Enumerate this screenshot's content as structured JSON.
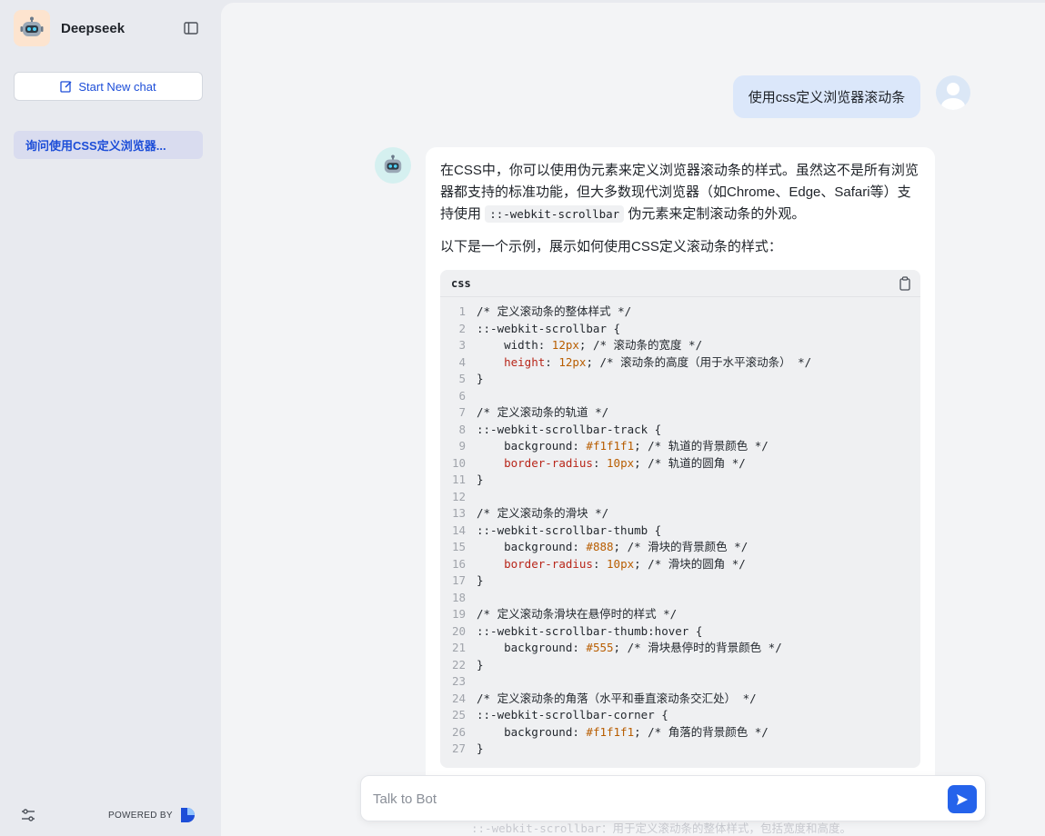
{
  "sidebar": {
    "brand_name": "Deepseek",
    "new_chat_label": "Start New chat",
    "history": [
      {
        "label": "询问使用CSS定义浏览器..."
      }
    ],
    "powered_by": "POWERED BY"
  },
  "chat": {
    "user_message": "使用css定义浏览器滚动条",
    "bot_para1_a": "在CSS中，你可以使用伪元素来定义浏览器滚动条的样式。虽然这不是所有浏览器都支持的标准功能，但大多数现代浏览器（如Chrome、Edge、Safari等）支持使用",
    "bot_para1_code": "::-webkit-scrollbar",
    "bot_para1_b": "伪元素来定制滚动条的外观。",
    "bot_para2": "以下是一个示例，展示如何使用CSS定义滚动条的样式：",
    "code_lang": "css",
    "code_lines": [
      {
        "n": "1",
        "t": "/* 定义滚动条的整体样式 */"
      },
      {
        "n": "2",
        "t": "::-webkit-scrollbar {"
      },
      {
        "n": "3",
        "t": "    width: 12px; /* 滚动条的宽度 */"
      },
      {
        "n": "4",
        "t": "    height: 12px; /* 滚动条的高度（用于水平滚动条） */"
      },
      {
        "n": "5",
        "t": "}"
      },
      {
        "n": "6",
        "t": ""
      },
      {
        "n": "7",
        "t": "/* 定义滚动条的轨道 */"
      },
      {
        "n": "8",
        "t": "::-webkit-scrollbar-track {"
      },
      {
        "n": "9",
        "t": "    background: #f1f1f1; /* 轨道的背景颜色 */"
      },
      {
        "n": "10",
        "t": "    border-radius: 10px; /* 轨道的圆角 */"
      },
      {
        "n": "11",
        "t": "}"
      },
      {
        "n": "12",
        "t": ""
      },
      {
        "n": "13",
        "t": "/* 定义滚动条的滑块 */"
      },
      {
        "n": "14",
        "t": "::-webkit-scrollbar-thumb {"
      },
      {
        "n": "15",
        "t": "    background: #888; /* 滑块的背景颜色 */"
      },
      {
        "n": "16",
        "t": "    border-radius: 10px; /* 滑块的圆角 */"
      },
      {
        "n": "17",
        "t": "}"
      },
      {
        "n": "18",
        "t": ""
      },
      {
        "n": "19",
        "t": "/* 定义滚动条滑块在悬停时的样式 */"
      },
      {
        "n": "20",
        "t": "::-webkit-scrollbar-thumb:hover {"
      },
      {
        "n": "21",
        "t": "    background: #555; /* 滑块悬停时的背景颜色 */"
      },
      {
        "n": "22",
        "t": "}"
      },
      {
        "n": "23",
        "t": ""
      },
      {
        "n": "24",
        "t": "/* 定义滚动条的角落（水平和垂直滚动条交汇处） */"
      },
      {
        "n": "25",
        "t": "::-webkit-scrollbar-corner {"
      },
      {
        "n": "26",
        "t": "    background: #f1f1f1; /* 角落的背景颜色 */"
      },
      {
        "n": "27",
        "t": "}"
      }
    ],
    "faded_line": "::-webkit-scrollbar：用于定义滚动条的整体样式，包括宽度和高度。"
  },
  "input": {
    "placeholder": "Talk to Bot"
  },
  "colors": {
    "accent": "#2563eb",
    "user_bubble": "#dbe7fa",
    "history_active": "#d9dcef"
  }
}
